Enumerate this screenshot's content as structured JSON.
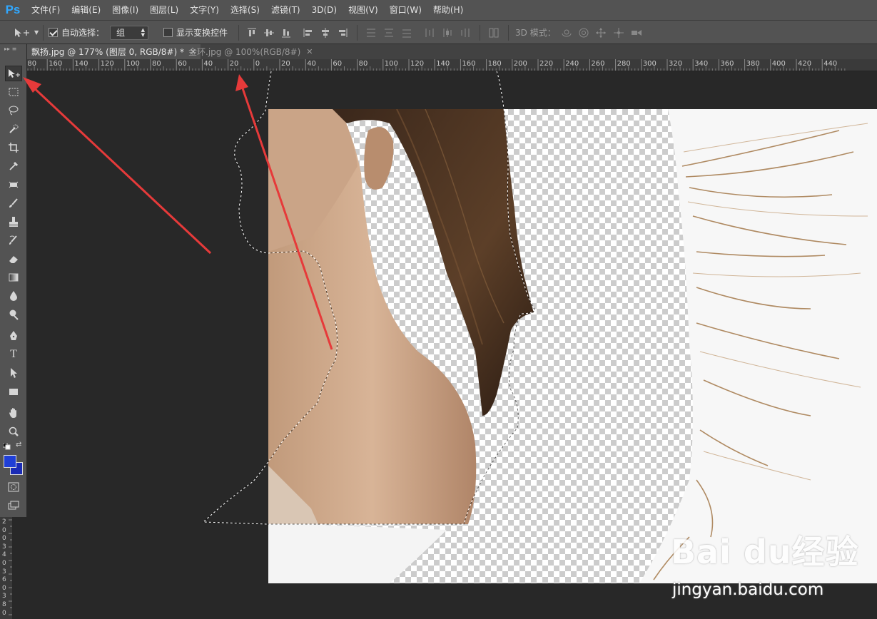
{
  "app": {
    "logo": "Ps"
  },
  "menu": [
    "文件(F)",
    "编辑(E)",
    "图像(I)",
    "图层(L)",
    "文字(Y)",
    "选择(S)",
    "滤镜(T)",
    "3D(D)",
    "视图(V)",
    "窗口(W)",
    "帮助(H)"
  ],
  "options": {
    "auto_select_label": "自动选择：",
    "auto_select_checked": true,
    "auto_select_value": "组",
    "show_transform_label": "显示变换控件",
    "show_transform_checked": false,
    "mode3d_label": "3D 模式："
  },
  "tabs": [
    {
      "label": "飘扬.jpg @ 177% (图层 0, RGB/8#) *",
      "active": true
    },
    {
      "label": "金环.jpg @ 100%(RGB/8#)",
      "active": false
    }
  ],
  "ruler_h": [
    "180",
    "160",
    "140",
    "120",
    "100",
    "80",
    "60",
    "40",
    "20",
    "0",
    "20",
    "40",
    "60",
    "80",
    "100",
    "120",
    "140",
    "160",
    "180",
    "200",
    "220",
    "240",
    "260",
    "280",
    "300",
    "320",
    "340",
    "360",
    "380",
    "400",
    "420",
    "440"
  ],
  "ruler_v": [
    "2",
    "0",
    "0",
    "3",
    "4",
    "0",
    "3",
    "6",
    "0",
    "3",
    "8",
    "0"
  ],
  "tools": [
    "move-tool",
    "marquee-tool",
    "lasso-tool",
    "quick-select-tool",
    "crop-tool",
    "eyedropper-tool",
    "healing-brush-tool",
    "brush-tool",
    "clone-stamp-tool",
    "history-brush-tool",
    "eraser-tool",
    "gradient-tool",
    "blur-tool",
    "dodge-tool",
    "pen-tool",
    "type-tool",
    "path-select-tool",
    "rectangle-tool",
    "hand-tool",
    "zoom-tool"
  ],
  "type_tool_glyph": "T",
  "colors": {
    "foreground": "#1f3fd6",
    "background": "#1a2bb5",
    "arrow": "#e63a3a"
  },
  "watermark": {
    "brand": "Bai du经验",
    "url": "jingyan.baidu.com"
  }
}
